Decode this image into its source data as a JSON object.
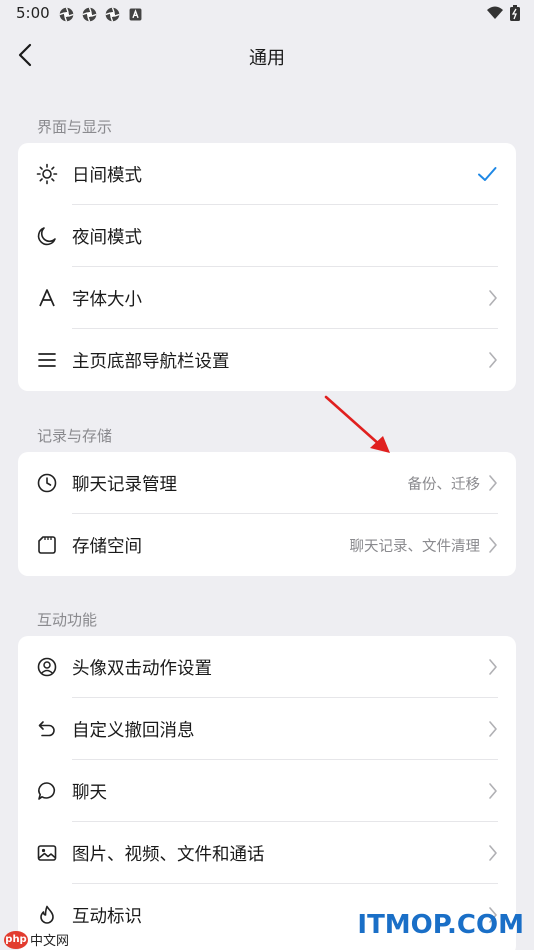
{
  "status_bar": {
    "time": "5:00",
    "notification_icons": [
      "app-icon",
      "app-icon",
      "app-icon",
      "a-letter-icon"
    ]
  },
  "nav": {
    "title": "通用"
  },
  "sections": [
    {
      "header": "界面与显示",
      "rows": [
        {
          "icon": "sun-icon",
          "label": "日间模式",
          "trailing": "check"
        },
        {
          "icon": "moon-icon",
          "label": "夜间模式",
          "trailing": "none"
        },
        {
          "icon": "font-icon",
          "label": "字体大小",
          "trailing": "chevron"
        },
        {
          "icon": "menu-icon",
          "label": "主页底部导航栏设置",
          "trailing": "chevron"
        }
      ]
    },
    {
      "header": "记录与存储",
      "rows": [
        {
          "icon": "clock-icon",
          "label": "聊天记录管理",
          "value": "备份、迁移",
          "trailing": "chevron"
        },
        {
          "icon": "storage-icon",
          "label": "存储空间",
          "value": "聊天记录、文件清理",
          "trailing": "chevron"
        }
      ]
    },
    {
      "header": "互动功能",
      "rows": [
        {
          "icon": "avatar-icon",
          "label": "头像双击动作设置",
          "trailing": "chevron"
        },
        {
          "icon": "undo-icon",
          "label": "自定义撤回消息",
          "trailing": "chevron"
        },
        {
          "icon": "chat-bubble-icon",
          "label": "聊天",
          "trailing": "chevron"
        },
        {
          "icon": "image-icon",
          "label": "图片、视频、文件和通话",
          "trailing": "chevron"
        },
        {
          "icon": "flame-icon",
          "label": "互动标识",
          "trailing": "chevron"
        }
      ]
    }
  ],
  "colors": {
    "accent": "#1e88e5",
    "background": "#eeeef2",
    "card": "#ffffff",
    "secondary_text": "#8a8a8e",
    "annotation_arrow": "#e0201f"
  },
  "watermarks": {
    "left_logo": "php",
    "left_site": "中文网",
    "right_site": "ITMOP.COM"
  }
}
